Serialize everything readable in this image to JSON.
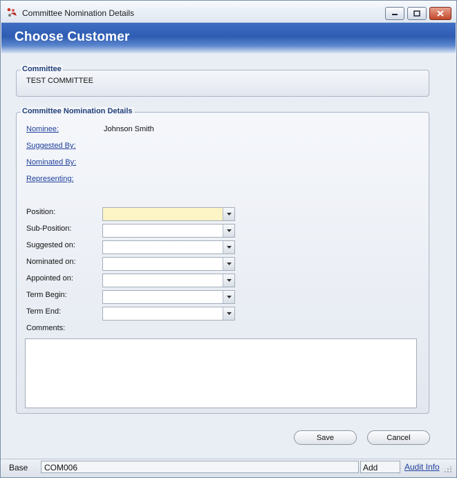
{
  "window": {
    "title": "Committee Nomination Details",
    "header_title": "Choose Customer"
  },
  "committee": {
    "legend": "Committee",
    "value": "TEST COMMITTEE"
  },
  "details": {
    "legend": "Committee Nomination Details",
    "nominee_label": "Nominee:",
    "nominee_value": "Johnson Smith",
    "suggested_by_label": "Suggested By:",
    "nominated_by_label": "Nominated By:",
    "representing_label": "Representing:",
    "fields": {
      "position": {
        "label": "Position:",
        "value": ""
      },
      "sub_position": {
        "label": "Sub-Position:",
        "value": ""
      },
      "suggested_on": {
        "label": "Suggested on:",
        "value": ""
      },
      "nominated_on": {
        "label": "Nominated on:",
        "value": ""
      },
      "appointed_on": {
        "label": "Appointed on:",
        "value": ""
      },
      "term_begin": {
        "label": "Term Begin:",
        "value": ""
      },
      "term_end": {
        "label": "Term End:",
        "value": ""
      }
    },
    "comments_label": "Comments:",
    "comments_value": ""
  },
  "buttons": {
    "save": "Save",
    "cancel": "Cancel"
  },
  "status": {
    "base": "Base",
    "code": "COM006",
    "mode": "Add",
    "audit": "Audit Info"
  },
  "colors": {
    "header_blue": "#2e5cb2",
    "link_blue": "#1f3f9b",
    "required_field": "#fdf5c5"
  }
}
